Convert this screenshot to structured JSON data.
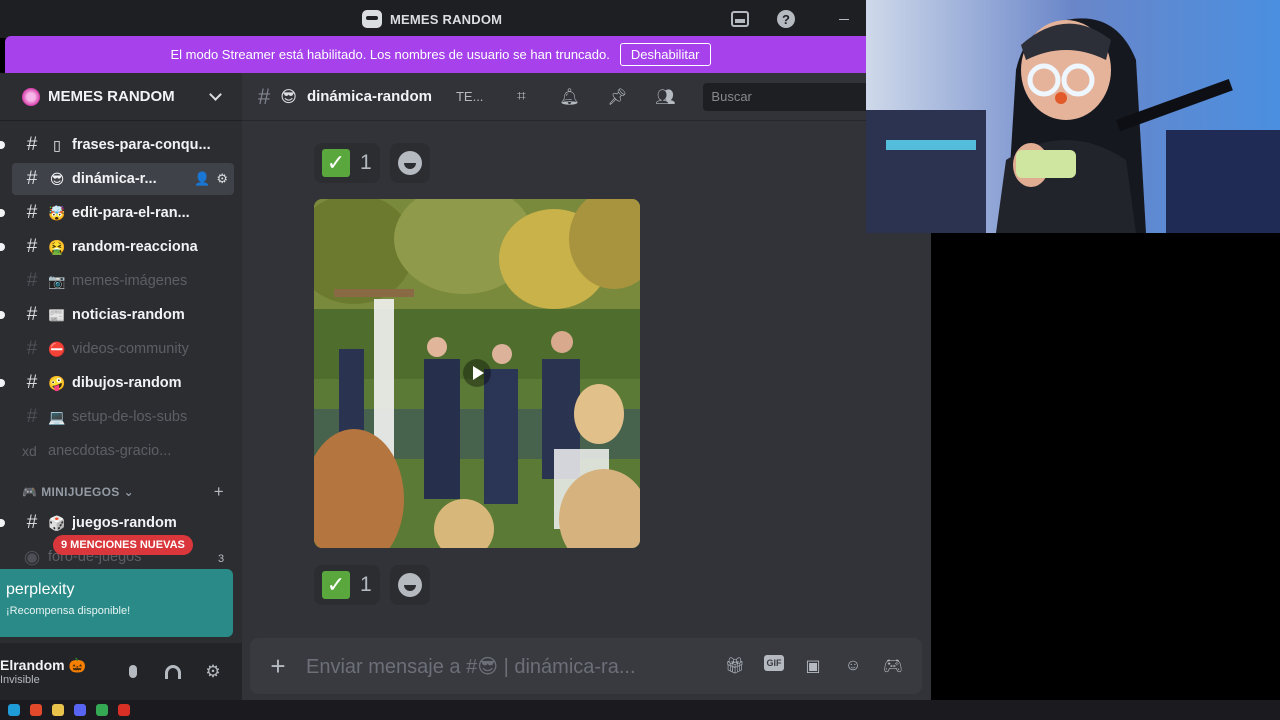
{
  "window": {
    "title": "MEMES RANDOM"
  },
  "banner": {
    "text": "El modo Streamer está habilitado. Los nombres de usuario se han truncado.",
    "button": "Deshabilitar"
  },
  "server": {
    "name": "MEMES RANDOM"
  },
  "channels": [
    {
      "emoji": "▯",
      "label": "frases-para-conqu...",
      "state": "unread"
    },
    {
      "emoji": "😎",
      "label": "dinámica-r...",
      "state": "active"
    },
    {
      "emoji": "🤯",
      "label": "edit-para-el-ran...",
      "state": "unread"
    },
    {
      "emoji": "🤮",
      "label": "random-reacciona",
      "state": "unread"
    },
    {
      "emoji": "📷",
      "label": "memes-imágenes",
      "state": "muted"
    },
    {
      "emoji": "📰",
      "label": "noticias-random",
      "state": "unread"
    },
    {
      "emoji": "⛔",
      "label": "videos-community",
      "state": "muted"
    },
    {
      "emoji": "🤪",
      "label": "dibujos-random",
      "state": "unread"
    },
    {
      "emoji": "💻",
      "label": "setup-de-los-subs",
      "state": "muted"
    },
    {
      "prefix": "xd",
      "label": "anecdotas-gracio...",
      "state": "muted"
    }
  ],
  "category": {
    "label": "MINIJUEGOS"
  },
  "category_channels": [
    {
      "emoji": "🎲",
      "label": "juegos-random",
      "state": "unread"
    },
    {
      "label": "foro-de-juegos",
      "state": "muted"
    }
  ],
  "mentions_pill": "9 MENCIONES NUEVAS",
  "forum_badge": "3",
  "promo": {
    "title": "perplexity",
    "subtitle": "¡Recompensa disponible!"
  },
  "user": {
    "name": "Elrandom 🎃",
    "status": "Invisible"
  },
  "chat": {
    "channel_emoji": "😎",
    "channel_name": "dinámica-random",
    "topic": "TE...",
    "search_placeholder": "Buscar",
    "reaction_count_1": "1",
    "reaction_count_2": "1",
    "composer_placeholder": "Enviar mensaje a #😎 | dinámica-ra..."
  },
  "colors": {
    "banner": "#a641ec",
    "sidebar": "#2b2d31",
    "chat": "#313338",
    "mention": "#da373c",
    "promo": "#2a8a87",
    "check": "#5aa83d"
  }
}
